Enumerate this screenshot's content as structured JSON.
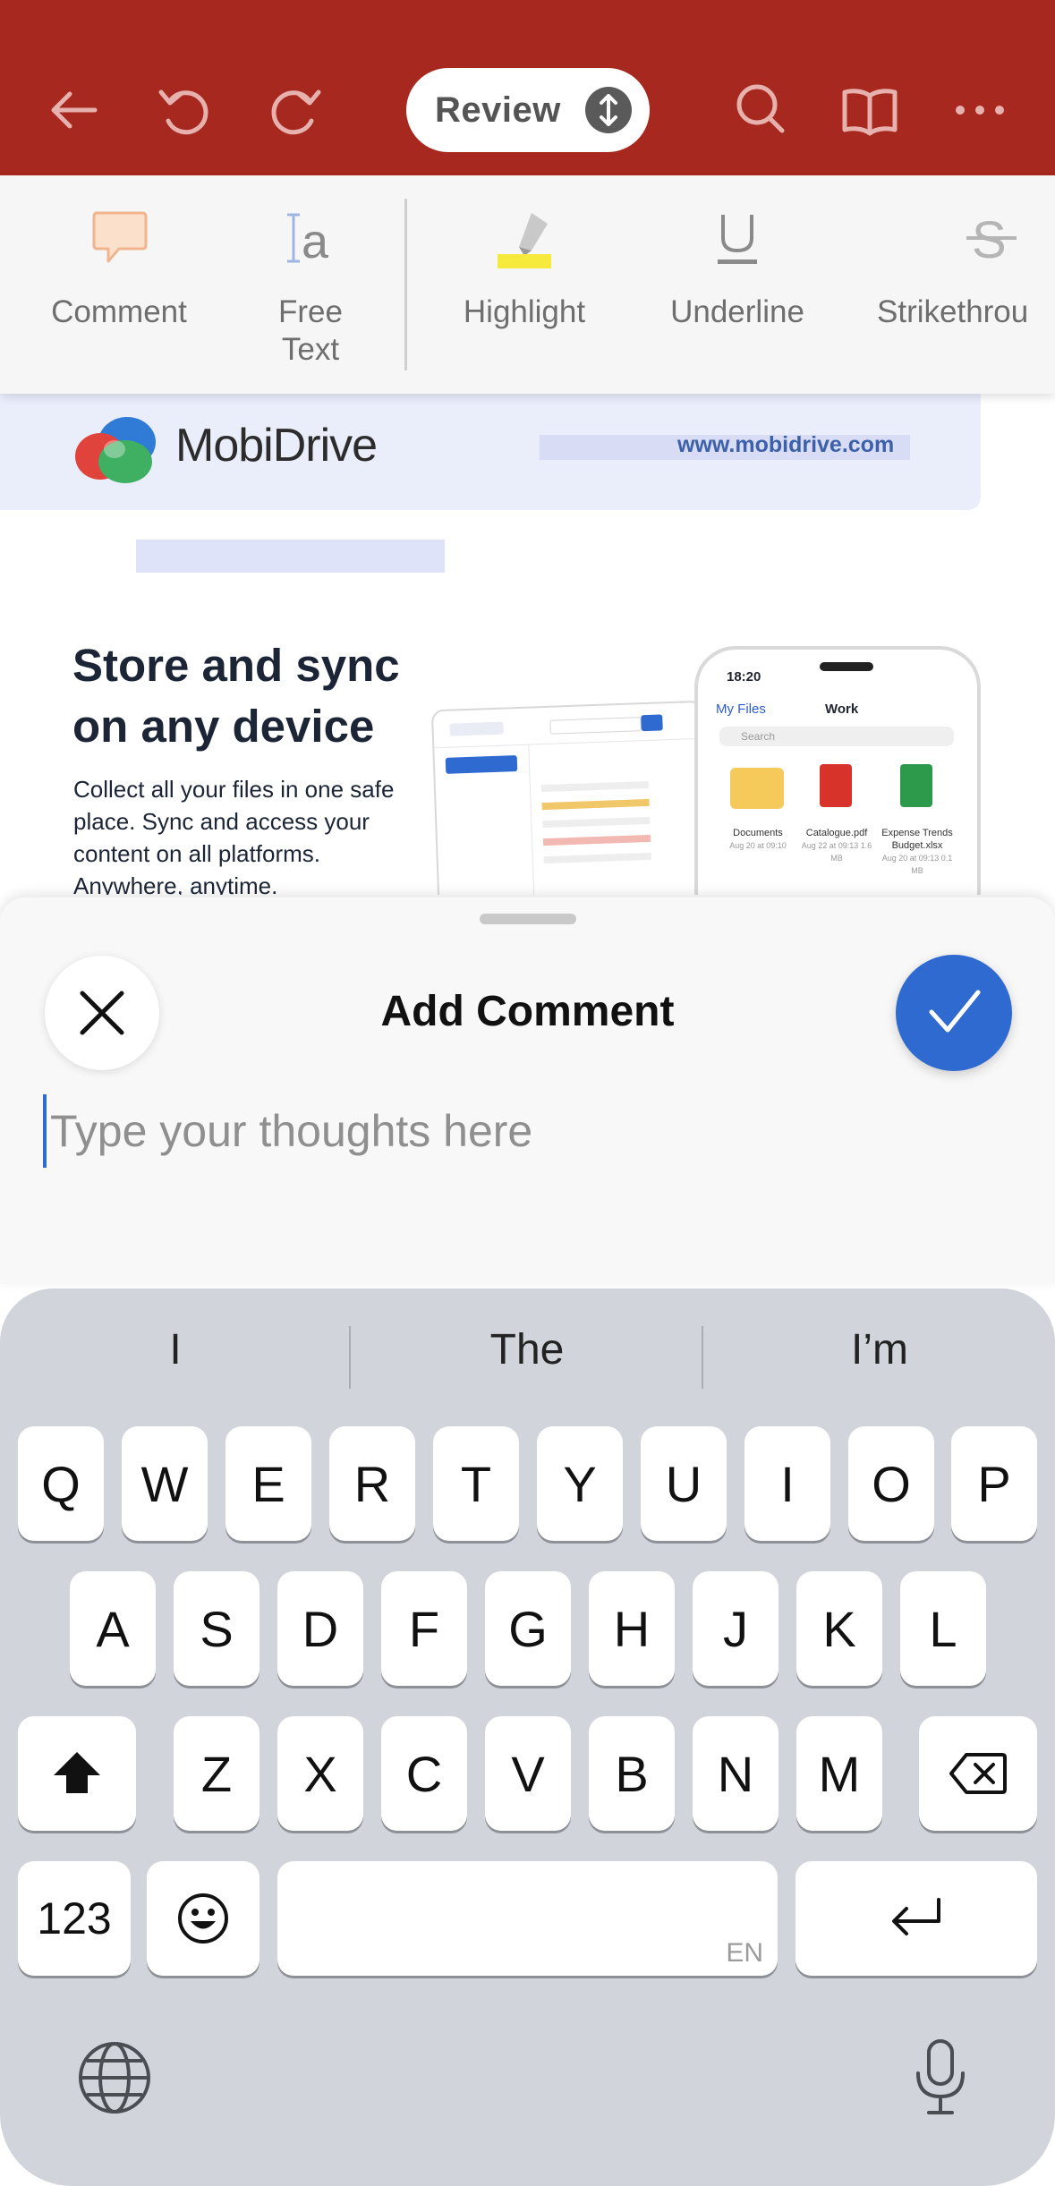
{
  "app": {
    "mode_label": "Review",
    "icons": [
      "back-arrow-icon",
      "undo-icon",
      "redo-icon",
      "search-icon",
      "book-icon",
      "more-icon"
    ],
    "accent_color": "#a6281f"
  },
  "toolbar": {
    "items": [
      {
        "label": "Comment",
        "icon": "comment-icon"
      },
      {
        "label": "Free\nText",
        "icon": "free-text-icon"
      },
      {
        "label": "Highlight",
        "icon": "highlighter-icon"
      },
      {
        "label": "Underline",
        "icon": "underline-icon"
      },
      {
        "label": "Strikethrou",
        "icon": "strikethrough-icon"
      }
    ]
  },
  "document": {
    "brand": "MobiDrive",
    "url": "www.mobidrive.com",
    "headline_line1": "Store and sync",
    "headline_line2": "on any device",
    "body": "Collect all your files in one safe place. Sync and access your content on all platforms. Anywhere, anytime.",
    "phone_mock": {
      "time": "18:20",
      "back": "My Files",
      "title": "Work",
      "search": "Search",
      "files": [
        {
          "name": "Documents",
          "sub": "Aug 20 at 09:10"
        },
        {
          "name": "Catalogue.pdf",
          "sub": "Aug 22 at 09:13 1.6 MB"
        },
        {
          "name": "Expense Trends Budget.xlsx",
          "sub": "Aug 20 at 09:13 0.1 MB"
        }
      ]
    }
  },
  "comment_sheet": {
    "title": "Add Comment",
    "placeholder": "Type your thoughts here",
    "value": "",
    "confirm_color": "#2f6ad1"
  },
  "keyboard": {
    "suggestions": [
      "I",
      "The",
      "I’m"
    ],
    "row1": [
      "Q",
      "W",
      "E",
      "R",
      "T",
      "Y",
      "U",
      "I",
      "O",
      "P"
    ],
    "row2": [
      "A",
      "S",
      "D",
      "F",
      "G",
      "H",
      "J",
      "K",
      "L"
    ],
    "row3": [
      "Z",
      "X",
      "C",
      "V",
      "B",
      "N",
      "M"
    ],
    "numbers_label": "123",
    "space_lang": "EN"
  }
}
